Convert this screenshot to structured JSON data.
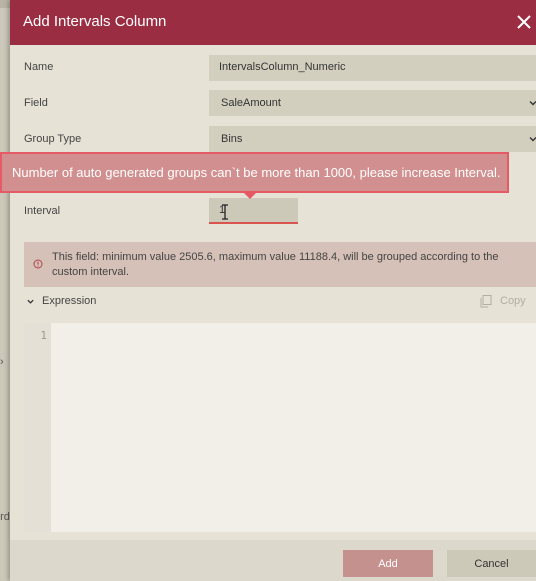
{
  "dialog": {
    "title": "Add Intervals Column"
  },
  "form": {
    "name": {
      "label": "Name",
      "value": "IntervalsColumn_Numeric"
    },
    "field": {
      "label": "Field",
      "value": "SaleAmount"
    },
    "group_type": {
      "label": "Group Type",
      "value": "Bins"
    },
    "interval": {
      "label": "Interval",
      "value": "1"
    }
  },
  "tooltip": {
    "message": "Number of auto generated groups can`t be more than 1000, please increase Interval."
  },
  "info": {
    "message": "This field: minimum value 2505.6, maximum value 11188.4, will be grouped according to the custom interval."
  },
  "expression": {
    "label": "Expression",
    "copy_label": "Copy",
    "line_numbers": [
      "1"
    ]
  },
  "footer": {
    "add_label": "Add",
    "cancel_label": "Cancel"
  },
  "background": {
    "partial_text": "ord"
  },
  "colors": {
    "title_bar": "#9a2d42",
    "tooltip_bg": "#d1908f",
    "tooltip_border": "#e55a64",
    "add_button": "#c4918f"
  },
  "icons": {
    "close": "close-icon",
    "chevron": "chevron-down-icon",
    "info": "info-circle-icon",
    "copy": "copy-icon",
    "cursor": "text-cursor-icon"
  }
}
